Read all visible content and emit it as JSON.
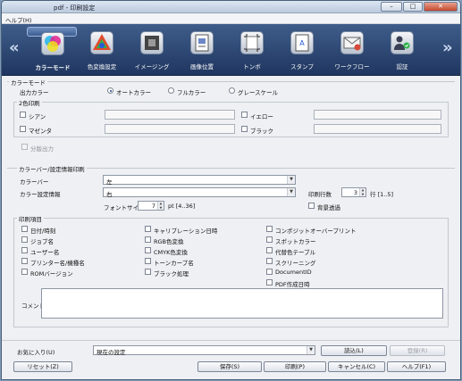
{
  "window": {
    "title": "pdf - 印刷設定",
    "btn_min": "–",
    "btn_max": "□",
    "btn_close": "✕"
  },
  "menu": {
    "help": "ヘルプ(H)"
  },
  "toolbar": {
    "prev": "«",
    "next": "»",
    "tools": [
      {
        "label": "カラーモード",
        "icon": "color-mode-icon",
        "selected": true
      },
      {
        "label": "色変換設定",
        "icon": "color-conversion-icon",
        "selected": false
      },
      {
        "label": "イメージング",
        "icon": "imaging-icon",
        "selected": false
      },
      {
        "label": "画像位置",
        "icon": "image-position-icon",
        "selected": false
      },
      {
        "label": "トンボ",
        "icon": "crop-marks-icon",
        "selected": false
      },
      {
        "label": "スタンプ",
        "icon": "stamp-icon",
        "selected": false
      },
      {
        "label": "ワークフロー",
        "icon": "workflow-icon",
        "selected": false
      },
      {
        "label": "認証",
        "icon": "authentication-icon",
        "selected": false
      }
    ]
  },
  "colormode": {
    "group_title": "カラーモード",
    "output_label": "出力カラー",
    "options": [
      "オートカラー",
      "フルカラー",
      "グレースケール"
    ],
    "selected": "オートカラー"
  },
  "twocolor": {
    "group_title": "2色印刷",
    "items": [
      "シアン",
      "マゼンタ",
      "イエロー",
      "ブラック"
    ],
    "separate": "分版出力"
  },
  "colorbar": {
    "group_title": "カラーバー/設定情報印刷",
    "colorbar_label": "カラーバー",
    "colorbar_value": "左",
    "info_label": "カラー設定情報",
    "info_value": "右",
    "lines_label": "印刷行数",
    "lines_value": "3",
    "lines_unit": "行 [1..5]",
    "fontsize_label": "フォントサイズ",
    "fontsize_value": "7",
    "fontsize_unit": "pt [4..36]",
    "transparent": "背景透過"
  },
  "printitems": {
    "group_title": "印刷項目",
    "col1": [
      "日付/時刻",
      "ジョブ名",
      "ユーザー名",
      "プリンター名/機種名",
      "ROMバージョン"
    ],
    "col2": [
      "キャリブレーション日時",
      "RGB色変換",
      "CMYK色変換",
      "トーンカーブ名",
      "ブラック処理"
    ],
    "col3": [
      "コンポジットオーバープリント",
      "スポットカラー",
      "代替色テーブル",
      "スクリーニング",
      "DocumentID",
      "PDF作成日時"
    ],
    "comment_label": "コメント"
  },
  "bottom": {
    "favorites_label": "お気に入り(U)",
    "favorites_value": "現在の設定",
    "load": "読込(L)",
    "register": "登録(R)",
    "reset": "リセット(Z)",
    "save": "保存(S)",
    "print": "印刷(P)",
    "cancel": "キャンセル(C)",
    "help": "ヘルプ(F1)"
  }
}
